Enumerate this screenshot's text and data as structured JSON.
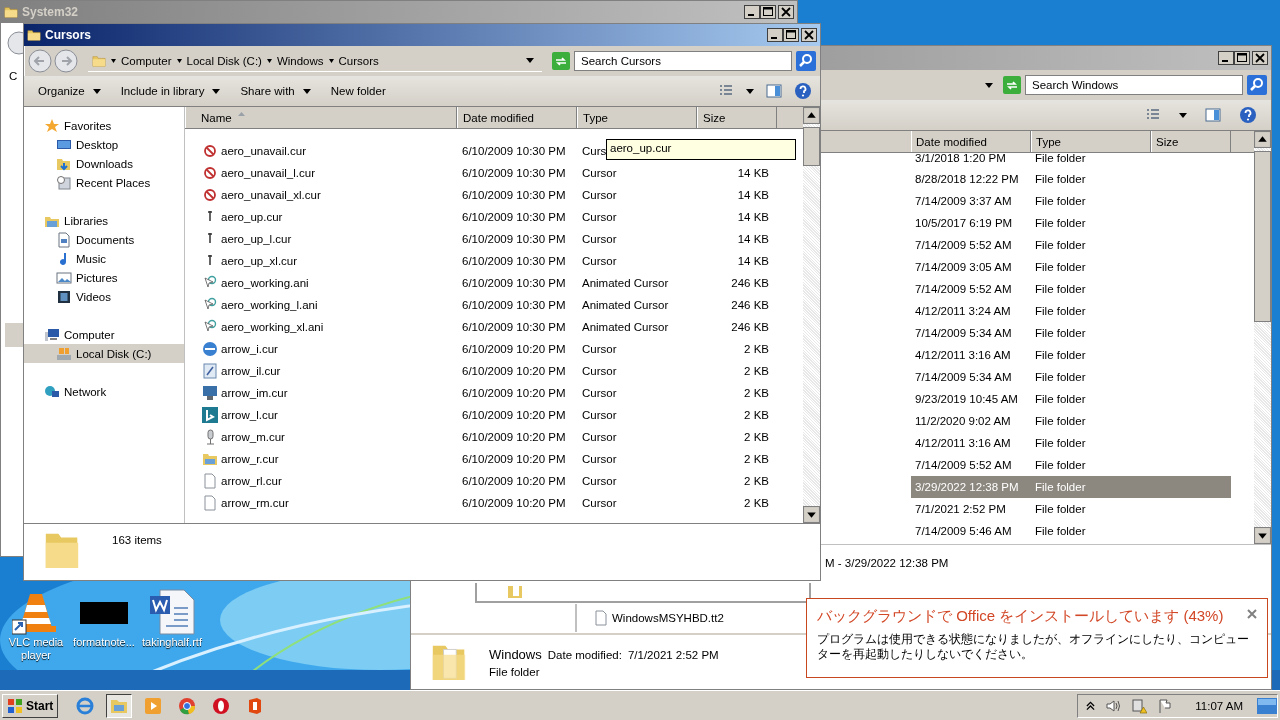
{
  "system32_window": {
    "title": "System32",
    "left_edge_text": "C"
  },
  "windows_window": {
    "search": {
      "placeholder": "Search Windows"
    },
    "columns": [
      {
        "label": "Date modified"
      },
      {
        "label": "Type"
      },
      {
        "label": "Size"
      }
    ],
    "rows": [
      {
        "date": "3/1/2018 1:20 PM",
        "type": "File folder",
        "selected": false
      },
      {
        "date": "8/28/2018 12:22 PM",
        "type": "File folder",
        "selected": false
      },
      {
        "date": "7/14/2009 3:37 AM",
        "type": "File folder",
        "selected": false
      },
      {
        "date": "10/5/2017 6:19 PM",
        "type": "File folder",
        "selected": false
      },
      {
        "date": "7/14/2009 5:52 AM",
        "type": "File folder",
        "selected": false
      },
      {
        "date": "7/14/2009 3:05 AM",
        "type": "File folder",
        "selected": false
      },
      {
        "date": "7/14/2009 5:52 AM",
        "type": "File folder",
        "selected": false
      },
      {
        "date": "4/12/2011 3:24 AM",
        "type": "File folder",
        "selected": false
      },
      {
        "date": "7/14/2009 5:34 AM",
        "type": "File folder",
        "selected": false
      },
      {
        "date": "4/12/2011 3:16 AM",
        "type": "File folder",
        "selected": false
      },
      {
        "date": "7/14/2009 5:34 AM",
        "type": "File folder",
        "selected": false
      },
      {
        "date": "9/23/2019 10:45 AM",
        "type": "File folder",
        "selected": false
      },
      {
        "date": "11/2/2020 9:02 AM",
        "type": "File folder",
        "selected": false
      },
      {
        "date": "4/12/2011 3:16 AM",
        "type": "File folder",
        "selected": false
      },
      {
        "date": "7/14/2009 5:52 AM",
        "type": "File folder",
        "selected": false
      },
      {
        "date": "3/29/2022 12:38 PM",
        "type": "File folder",
        "selected": true
      },
      {
        "date": "7/1/2021 2:52 PM",
        "type": "File folder",
        "selected": false
      },
      {
        "date": "7/14/2009 5:46 AM",
        "type": "File folder",
        "selected": false
      }
    ],
    "info_text": "M - 3/29/2022 12:38 PM",
    "drag_item": "WindowsMSYHBD.tt2",
    "details": {
      "name": "Windows",
      "date_label": "Date modified:",
      "date": "7/1/2021 2:52 PM",
      "type": "File folder"
    }
  },
  "cursors_window": {
    "title": "Cursors",
    "breadcrumb": [
      "Computer",
      "Local Disk (C:)",
      "Windows",
      "Cursors"
    ],
    "search": {
      "placeholder": "Search Cursors"
    },
    "toolbar": [
      {
        "label": "Organize",
        "kind": "menu"
      },
      {
        "label": "Include in library",
        "kind": "menu"
      },
      {
        "label": "Share with",
        "kind": "menu"
      },
      {
        "label": "New folder",
        "kind": "button"
      }
    ],
    "nav": [
      {
        "label": "Favorites",
        "kind": "star",
        "selected": false,
        "children": [
          {
            "label": "Desktop",
            "kind": "desktop",
            "selected": false
          },
          {
            "label": "Downloads",
            "kind": "downloads",
            "selected": false
          },
          {
            "label": "Recent Places",
            "kind": "recent",
            "selected": false
          }
        ]
      },
      {
        "label": "Libraries",
        "kind": "libraries",
        "selected": false,
        "children": [
          {
            "label": "Documents",
            "kind": "document",
            "selected": false
          },
          {
            "label": "Music",
            "kind": "music",
            "selected": false
          },
          {
            "label": "Pictures",
            "kind": "pictures",
            "selected": false
          },
          {
            "label": "Videos",
            "kind": "videos",
            "selected": false
          }
        ]
      },
      {
        "label": "Computer",
        "kind": "computer",
        "selected": false,
        "children": [
          {
            "label": "Local Disk (C:)",
            "kind": "disk",
            "selected": true
          }
        ]
      },
      {
        "label": "Network",
        "kind": "network",
        "selected": false
      }
    ],
    "columns": [
      {
        "label": "Name",
        "sorted": true
      },
      {
        "label": "Date modified",
        "sorted": false
      },
      {
        "label": "Type",
        "sorted": false
      },
      {
        "label": "Size",
        "sorted": false
      }
    ],
    "rows": [
      {
        "name": "aero_unavail.cur",
        "date": "6/10/2009 10:30 PM",
        "type": "Curs",
        "kind": "unavail"
      },
      {
        "name": "aero_unavail_l.cur",
        "date": "6/10/2009 10:30 PM",
        "type": "Cursor",
        "size": "14 KB",
        "kind": "unavail"
      },
      {
        "name": "aero_unavail_xl.cur",
        "date": "6/10/2009 10:30 PM",
        "type": "Cursor",
        "size": "14 KB",
        "kind": "unavail"
      },
      {
        "name": "aero_up.cur",
        "date": "6/10/2009 10:30 PM",
        "type": "Cursor",
        "size": "14 KB",
        "kind": "up"
      },
      {
        "name": "aero_up_l.cur",
        "date": "6/10/2009 10:30 PM",
        "type": "Cursor",
        "size": "14 KB",
        "kind": "up"
      },
      {
        "name": "aero_up_xl.cur",
        "date": "6/10/2009 10:30 PM",
        "type": "Cursor",
        "size": "14 KB",
        "kind": "up"
      },
      {
        "name": "aero_working.ani",
        "date": "6/10/2009 10:30 PM",
        "type": "Animated Cursor",
        "size": "246 KB",
        "kind": "working"
      },
      {
        "name": "aero_working_l.ani",
        "date": "6/10/2009 10:30 PM",
        "type": "Animated Cursor",
        "size": "246 KB",
        "kind": "working"
      },
      {
        "name": "aero_working_xl.ani",
        "date": "6/10/2009 10:30 PM",
        "type": "Animated Cursor",
        "size": "246 KB",
        "kind": "working"
      },
      {
        "name": "arrow_i.cur",
        "date": "6/10/2009 10:20 PM",
        "type": "Cursor",
        "size": "2 KB",
        "kind": "globe"
      },
      {
        "name": "arrow_il.cur",
        "date": "6/10/2009 10:20 PM",
        "type": "Cursor",
        "size": "2 KB",
        "kind": "paint"
      },
      {
        "name": "arrow_im.cur",
        "date": "6/10/2009 10:20 PM",
        "type": "Cursor",
        "size": "2 KB",
        "kind": "monitor"
      },
      {
        "name": "arrow_l.cur",
        "date": "6/10/2009 10:20 PM",
        "type": "Cursor",
        "size": "2 KB",
        "kind": "tile"
      },
      {
        "name": "arrow_m.cur",
        "date": "6/10/2009 10:20 PM",
        "type": "Cursor",
        "size": "2 KB",
        "kind": "mic"
      },
      {
        "name": "arrow_r.cur",
        "date": "6/10/2009 10:20 PM",
        "type": "Cursor",
        "size": "2 KB",
        "kind": "folder"
      },
      {
        "name": "arrow_rl.cur",
        "date": "6/10/2009 10:20 PM",
        "type": "Cursor",
        "size": "2 KB",
        "kind": "blank"
      },
      {
        "name": "arrow_rm.cur",
        "date": "6/10/2009 10:20 PM",
        "type": "Cursor",
        "size": "2 KB",
        "kind": "blank"
      }
    ],
    "tooltip": "aero_up.cur",
    "status": "163 items"
  },
  "desktop_icons": [
    {
      "label": "VLC media player",
      "kind": "vlc"
    },
    {
      "label": "formatnote...",
      "kind": "thumbnail"
    },
    {
      "label": "takinghalf.rtf",
      "kind": "word"
    }
  ],
  "notification": {
    "title": "バックグラウンドで Office をインストールしています (43%)",
    "body": "プログラムは使用できる状態になりましたが、オフラインにしたり、コンピューターを再起動したりしないでください。"
  },
  "taskbar": {
    "start": "Start",
    "apps": [
      {
        "kind": "ie",
        "selected": false
      },
      {
        "kind": "explorer",
        "selected": true
      },
      {
        "kind": "media",
        "selected": false
      },
      {
        "kind": "chrome",
        "selected": false
      },
      {
        "kind": "opera",
        "selected": false
      },
      {
        "kind": "office",
        "selected": false
      }
    ],
    "clock": "11:07 AM"
  }
}
